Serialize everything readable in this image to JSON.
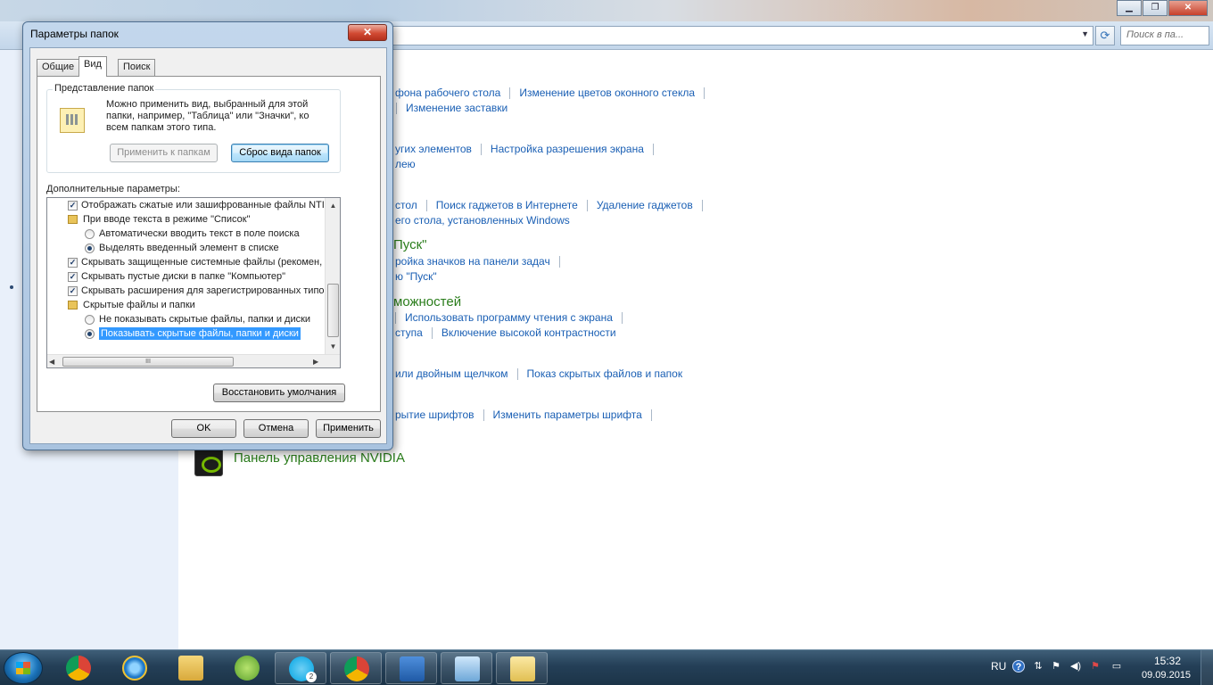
{
  "control_panel": {
    "search_placeholder": "Поиск в па...",
    "links": {
      "row1_a": "фона рабочего стола",
      "row1_b": "Изменение цветов оконного стекла",
      "row2_a": "Изменение заставки",
      "row3_a": "угих элементов",
      "row3_b": "Настройка разрешения экрана",
      "row4_a": "лею",
      "row5_a": "стол",
      "row5_b": "Поиск гаджетов в Интернете",
      "row5_c": "Удаление гаджетов",
      "row6_a": "его стола, установленных Windows",
      "row8_a": "ройка значков на панели задач",
      "row9_a": "ю \"Пуск\"",
      "row11_a": "Использовать программу чтения с экрана",
      "row12_a": "ступа",
      "row12_b": "Включение высокой контрастности",
      "row13_a": "или двойным щелчком",
      "row13_b": "Показ скрытых файлов и папок",
      "row14_a": "рытие шрифтов",
      "row14_b": "Изменить параметры шрифта"
    },
    "headings": {
      "start_menu": "Пуск\"",
      "accessibility": "можностей",
      "nvidia": "Панель управления NVIDIA"
    }
  },
  "dialog": {
    "title": "Параметры папок",
    "close_glyph": "✕",
    "tabs": [
      "Общие",
      "Вид",
      "Поиск"
    ],
    "active_tab": "Вид",
    "folder_view": {
      "legend": "Представление папок",
      "description": "Можно применить вид, выбранный для этой папки, например, \"Таблица\" или \"Значки\", ко всем папкам этого типа.",
      "apply_button": "Применить к папкам",
      "reset_button": "Сброс вида папок"
    },
    "advanced_label": "Дополнительные параметры:",
    "advanced_items": [
      {
        "kind": "checkbox",
        "checked": true,
        "label": "Отображать сжатые или зашифрованные файлы NTI"
      },
      {
        "kind": "folder",
        "label": "При вводе текста в режиме \"Список\""
      },
      {
        "kind": "radio",
        "checked": false,
        "label": "Автоматически вводить текст в поле поиска"
      },
      {
        "kind": "radio",
        "checked": true,
        "label": "Выделять введенный элемент в списке"
      },
      {
        "kind": "checkbox",
        "checked": true,
        "label": "Скрывать защищенные системные файлы (рекомен,"
      },
      {
        "kind": "checkbox",
        "checked": true,
        "label": "Скрывать пустые диски в папке \"Компьютер\""
      },
      {
        "kind": "checkbox",
        "checked": true,
        "label": "Скрывать расширения для зарегистрированных типо"
      },
      {
        "kind": "folder",
        "label": "Скрытые файлы и папки"
      },
      {
        "kind": "radio",
        "checked": false,
        "label": "Не показывать скрытые файлы, папки и диски"
      },
      {
        "kind": "radio",
        "checked": true,
        "label": "Показывать скрытые файлы, папки и диски"
      }
    ],
    "restore_defaults": "Восстановить умолчания",
    "ok": "OK",
    "cancel": "Отмена",
    "apply": "Применить",
    "hscroll_grip": "III"
  },
  "taskbar": {
    "apps": [
      "chrome",
      "internet-explorer",
      "windows-explorer",
      "utorrent",
      "skype",
      "chrome",
      "word",
      "control-panel",
      "folder-options"
    ],
    "skype_badge": "2",
    "language": "RU",
    "time": "15:32",
    "date": "09.09.2015"
  },
  "colors": {
    "link": "#1a5fb4",
    "heading_green": "#2a7d1b",
    "selection": "#3399ff"
  }
}
